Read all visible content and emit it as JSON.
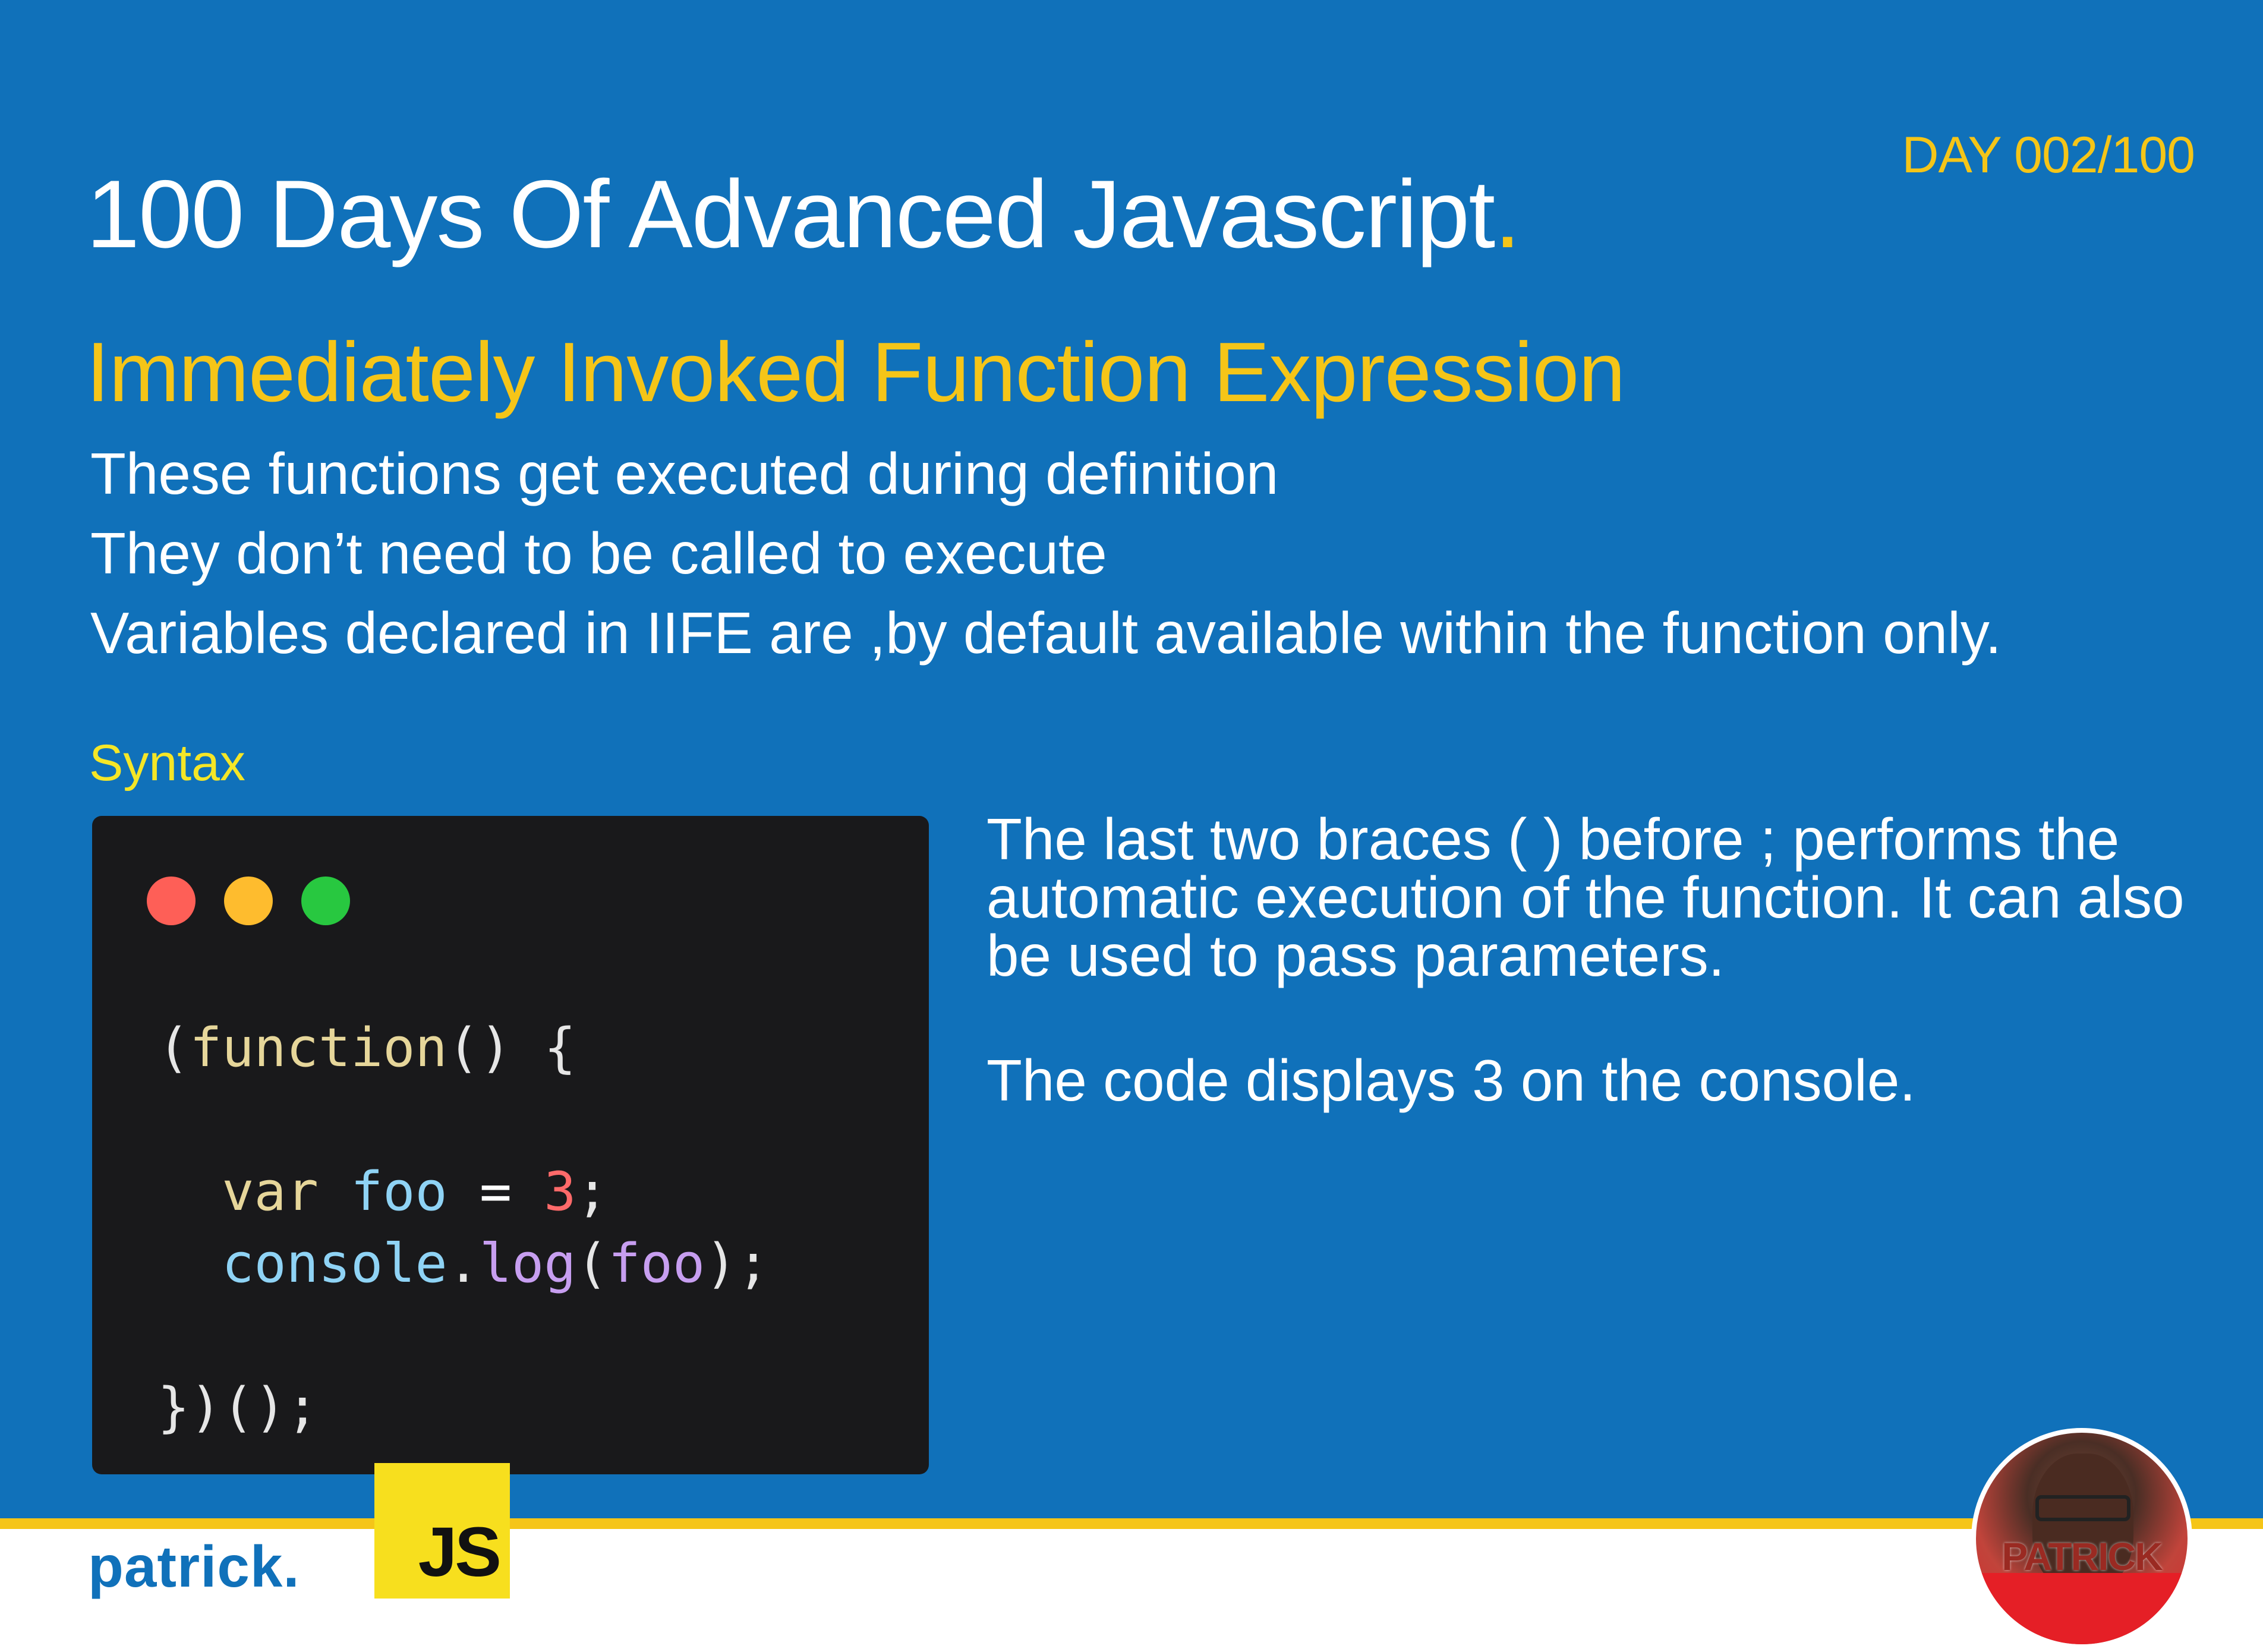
{
  "header": {
    "day_label": "DAY 002/100",
    "title": "100 Days Of Advanced Javascript",
    "title_dot": "."
  },
  "topic": {
    "heading": "Immediately Invoked Function Expression",
    "bullets": [
      "These functions get executed during definition",
      "They don’t need to be called to execute",
      "Variables declared in IIFE are ,by default available within the function only."
    ]
  },
  "syntax": {
    "label": "Syntax",
    "code": {
      "l1_open": "(",
      "l1_keyword": "function",
      "l1_rest": "() {",
      "l2_keyword": "var",
      "l2_name": "foo",
      "l2_op": " = ",
      "l2_value": "3",
      "l2_end": ";",
      "l3_obj": "console",
      "l3_dot": ".",
      "l3_method": "log",
      "l3_open": "(",
      "l3_arg": "foo",
      "l3_close": ");",
      "l4": "})();"
    }
  },
  "description": {
    "paragraph_1": "The last two braces ( ) before ; performs the automatic execution of the function. It can also be used to pass parameters.",
    "paragraph_2": "The code displays 3 on the console."
  },
  "footer": {
    "brand": "patrick.",
    "js_logo_text": "JS",
    "avatar_label": "PATRICK"
  },
  "colors": {
    "background": "#1071ba",
    "accent_yellow": "#f5c518",
    "code_bg": "#19191b",
    "js_yellow": "#f7df1e"
  },
  "icons": [
    "window-close-dot",
    "window-minimize-dot",
    "window-maximize-dot",
    "js-logo",
    "avatar"
  ]
}
